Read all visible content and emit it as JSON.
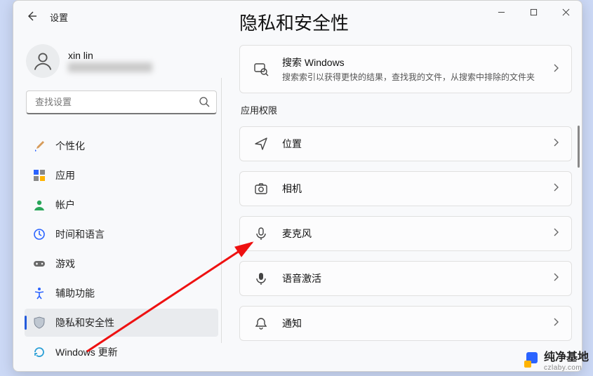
{
  "window": {
    "app_title": "设置",
    "page_title": "隐私和安全性"
  },
  "user": {
    "name": "xin lin"
  },
  "search": {
    "placeholder": "查找设置"
  },
  "sidebar": {
    "items": [
      {
        "label": "个性化"
      },
      {
        "label": "应用"
      },
      {
        "label": "帐户"
      },
      {
        "label": "时间和语言"
      },
      {
        "label": "游戏"
      },
      {
        "label": "辅助功能"
      },
      {
        "label": "隐私和安全性"
      },
      {
        "label": "Windows 更新"
      }
    ]
  },
  "main": {
    "search_windows": {
      "title": "搜索 Windows",
      "sub": "搜索索引以获得更快的结果，查找我的文件，从搜索中排除的文件夹"
    },
    "section_label": "应用权限",
    "items": [
      {
        "label": "位置"
      },
      {
        "label": "相机"
      },
      {
        "label": "麦克风"
      },
      {
        "label": "语音激活"
      },
      {
        "label": "通知"
      }
    ]
  },
  "watermark": {
    "text": "纯净基地",
    "sub": "czlaby.com"
  }
}
